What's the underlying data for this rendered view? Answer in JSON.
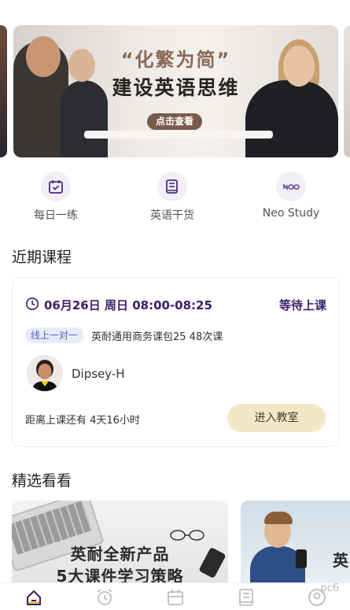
{
  "banner": {
    "title_line1": "“化繁为简”",
    "title_line2": "建设英语思维",
    "button_label": "点击查看"
  },
  "quick_entries": [
    {
      "label": "每日一练",
      "icon": "calendar-check-icon"
    },
    {
      "label": "英语干货",
      "icon": "book-icon"
    },
    {
      "label": "Neo Study",
      "icon": "neo-logo-icon"
    }
  ],
  "recent_section": {
    "title": "近期课程"
  },
  "course_card": {
    "datetime": "06月26日 周日 08:00-08:25",
    "status": "等待上课",
    "tag": "线上一对一",
    "course_name": "英耐通用商务课包25 48次课",
    "teacher_name": "Dipsey-H",
    "countdown": "距离上课还有 4天16小时",
    "enter_button": "进入教室"
  },
  "featured_section": {
    "title": "精选看看"
  },
  "featured_cards": [
    {
      "line1": "英耐全新产品",
      "line2": "5大课件学习策略"
    },
    {
      "line1": "英"
    }
  ],
  "tab_bar": {
    "tabs": [
      {
        "icon": "home-icon",
        "active": true
      },
      {
        "icon": "alarm-clock-icon",
        "active": false
      },
      {
        "icon": "calendar-icon",
        "active": false
      },
      {
        "icon": "document-icon",
        "active": false
      },
      {
        "icon": "user-icon",
        "active": false
      }
    ]
  },
  "watermark": "pc6",
  "colors": {
    "accent_purple": "#3b1e6b",
    "enter_button_bg": "#f3e7c8",
    "tag_bg": "#e7ecf8",
    "tab_active": "#f2c94c"
  }
}
